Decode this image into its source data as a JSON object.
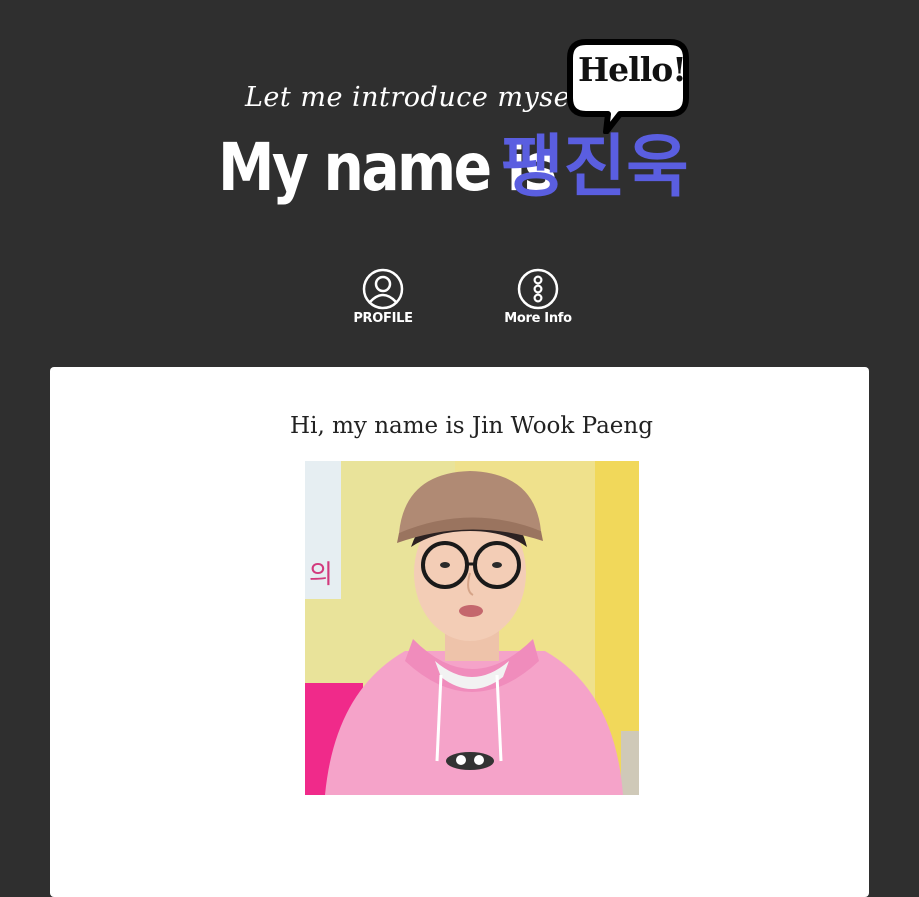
{
  "header": {
    "intro": "Let me introduce myself",
    "hello": "Hello!",
    "name_prefix": "My name is",
    "name_korean": "팽진욱"
  },
  "nav": {
    "profile_label": "PROFILE",
    "more_label": "More Info",
    "profile_icon": "user-circle-icon",
    "more_icon": "vertical-dots-circle-icon"
  },
  "card": {
    "title": "Hi, my name is Jin Wook Paeng",
    "photo_sign_text": "의"
  },
  "colors": {
    "background": "#2f2f2f",
    "accent": "#5a5ee0",
    "card": "#ffffff"
  }
}
